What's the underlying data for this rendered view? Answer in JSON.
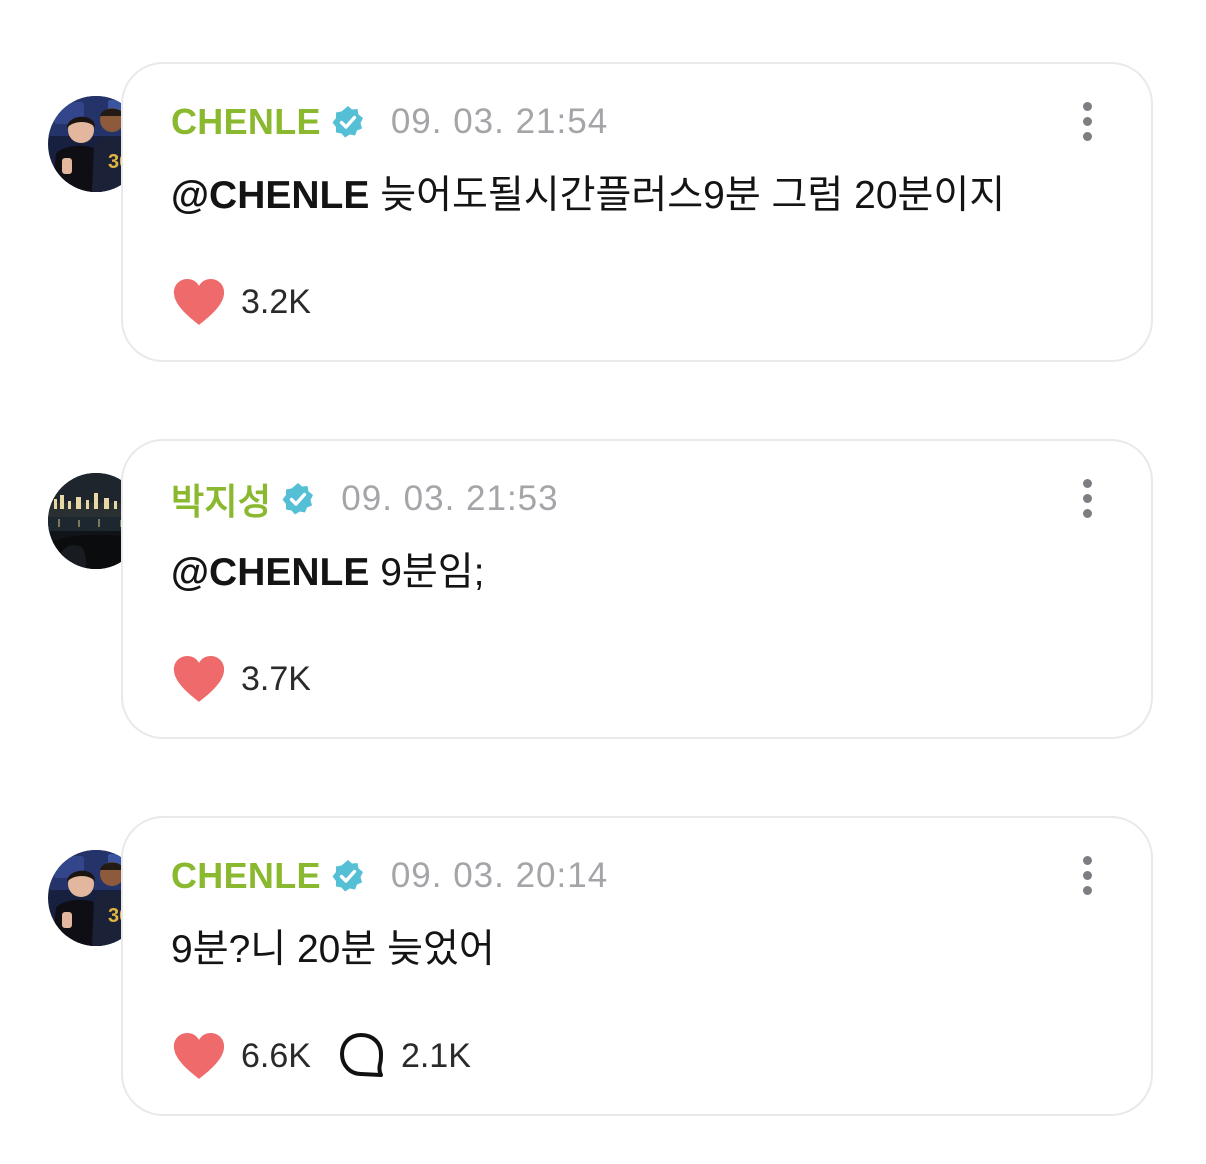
{
  "colors": {
    "author": "#8ab82f",
    "verified_badge": "#55bfd6",
    "timestamp": "#a4a4a9",
    "heart": "#ef6b6b",
    "card_border": "#e9e9ec"
  },
  "posts": [
    {
      "author": "CHENLE",
      "verified": true,
      "timestamp": "09. 03. 21:54",
      "mention": "@CHENLE",
      "text": " 늦어도될시간플러스9분 그럼 20분이지",
      "likes": "3.2K",
      "avatar_icon": "profile-photo-two-people"
    },
    {
      "author": "박지성",
      "verified": true,
      "timestamp": "09. 03. 21:53",
      "mention": "@CHENLE",
      "text": " 9분임;",
      "likes": "3.7K",
      "avatar_icon": "profile-photo-night-cityscape"
    },
    {
      "author": "CHENLE",
      "verified": true,
      "timestamp": "09. 03. 20:14",
      "mention": "",
      "text": "9분?니 20분 늦었어",
      "likes": "6.6K",
      "comments": "2.1K",
      "avatar_icon": "profile-photo-two-people"
    }
  ]
}
